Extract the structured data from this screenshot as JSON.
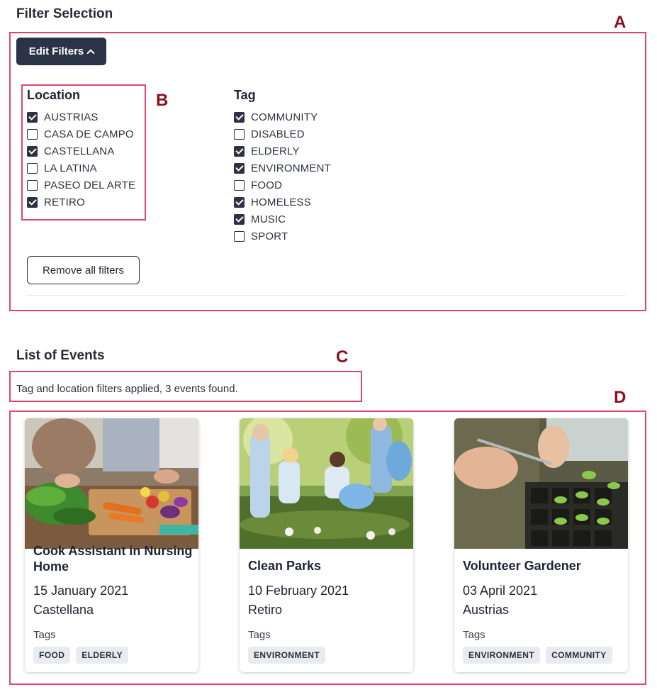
{
  "filter_section": {
    "title": "Filter Selection",
    "edit_button": "Edit Filters",
    "location": {
      "title": "Location",
      "options": [
        {
          "label": "AUSTRIAS",
          "checked": true
        },
        {
          "label": "CASA DE CAMPO",
          "checked": false
        },
        {
          "label": "CASTELLANA",
          "checked": true
        },
        {
          "label": "LA LATINA",
          "checked": false
        },
        {
          "label": "PASEO DEL ARTE",
          "checked": false
        },
        {
          "label": "RETIRO",
          "checked": true
        }
      ]
    },
    "tag": {
      "title": "Tag",
      "options": [
        {
          "label": "COMMUNITY",
          "checked": true
        },
        {
          "label": "DISABLED",
          "checked": false
        },
        {
          "label": "ELDERLY",
          "checked": true
        },
        {
          "label": "ENVIRONMENT",
          "checked": true
        },
        {
          "label": "FOOD",
          "checked": false
        },
        {
          "label": "HOMELESS",
          "checked": true
        },
        {
          "label": "MUSIC",
          "checked": true
        },
        {
          "label": "SPORT",
          "checked": false
        }
      ]
    },
    "remove_button": "Remove all filters"
  },
  "events_section": {
    "title": "List of Events",
    "status": "Tag and location filters applied, 3 events found.",
    "tags_label": "Tags",
    "events": [
      {
        "title": "Cook Assistant in Nursing Home",
        "date": "15 January 2021",
        "location": "Castellana",
        "tags": [
          "FOOD",
          "ELDERLY"
        ],
        "image_icon": "cooking-photo"
      },
      {
        "title": "Clean Parks",
        "date": "10 February 2021",
        "location": "Retiro",
        "tags": [
          "ENVIRONMENT"
        ],
        "image_icon": "park-cleanup-photo"
      },
      {
        "title": "Volunteer Gardener",
        "date": "03 April 2021",
        "location": "Austrias",
        "tags": [
          "ENVIRONMENT",
          "COMMUNITY"
        ],
        "image_icon": "seedlings-photo"
      }
    ]
  },
  "annotations": {
    "a": "A",
    "b": "B",
    "c": "C",
    "d": "D"
  },
  "colors": {
    "callout_border": "#e0466a",
    "callout_letter": "#8a0f1c",
    "primary_button": "#2b3347"
  }
}
